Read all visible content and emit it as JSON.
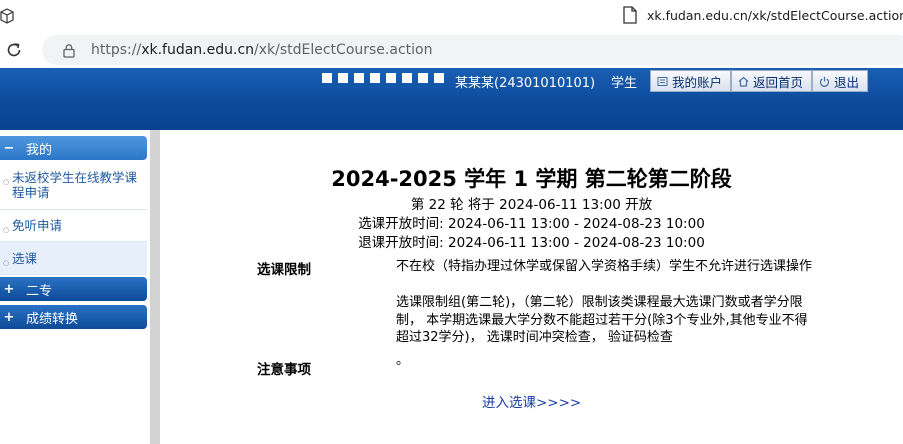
{
  "browser": {
    "tab_title": "xk.fudan.edu.cn/xk/stdElectCourse.action",
    "url_prefix": "https://",
    "url_host": "xk.fudan.edu.cn",
    "url_path": "/xk/stdElectCourse.action"
  },
  "header": {
    "user_name": "某某某(24301010101)",
    "user_role": "学生",
    "buttons": {
      "account": "我的账户",
      "home": "返回首页",
      "logout": "退出"
    }
  },
  "sidebar": {
    "groups": [
      {
        "label": "我的",
        "sign": "−"
      },
      {
        "label": "二专",
        "sign": "+"
      },
      {
        "label": "成绩转换",
        "sign": "+"
      }
    ],
    "items": [
      {
        "label": "未返校学生在线教学课程申请"
      },
      {
        "label": "免听申请"
      },
      {
        "label": "选课"
      }
    ]
  },
  "main": {
    "title": "2024-2025 学年 1 学期 第二轮第二阶段",
    "round_info": "第 22 轮 将于 2024-06-11 13:00  开放",
    "elect_time": "选课开放时间: 2024-06-11 13:00 - 2024-08-23 10:00",
    "drop_time": "退课开放时间: 2024-06-11 13:00 - 2024-08-23 10:00",
    "restriction_label": "选课限制",
    "restriction_line1": "不在校（特指办理过休学或保留入学资格手续）学生不允许进行选课操作",
    "restriction_line2": "选课限制组(第二轮)，（第二轮）限制该类课程最大选课门数或者学分限制， 本学期选课最大学分数不能超过若干分(除3个专业外,其他专业不得超过32学分)， 选课时间冲突检查， 验证码检查",
    "notice_label": "注意事项",
    "notice_text": "。",
    "enter_link": "进入选课>>>>"
  },
  "colors": {
    "header_blue": "#0b4a9a",
    "link_blue": "#1a3fa6"
  }
}
